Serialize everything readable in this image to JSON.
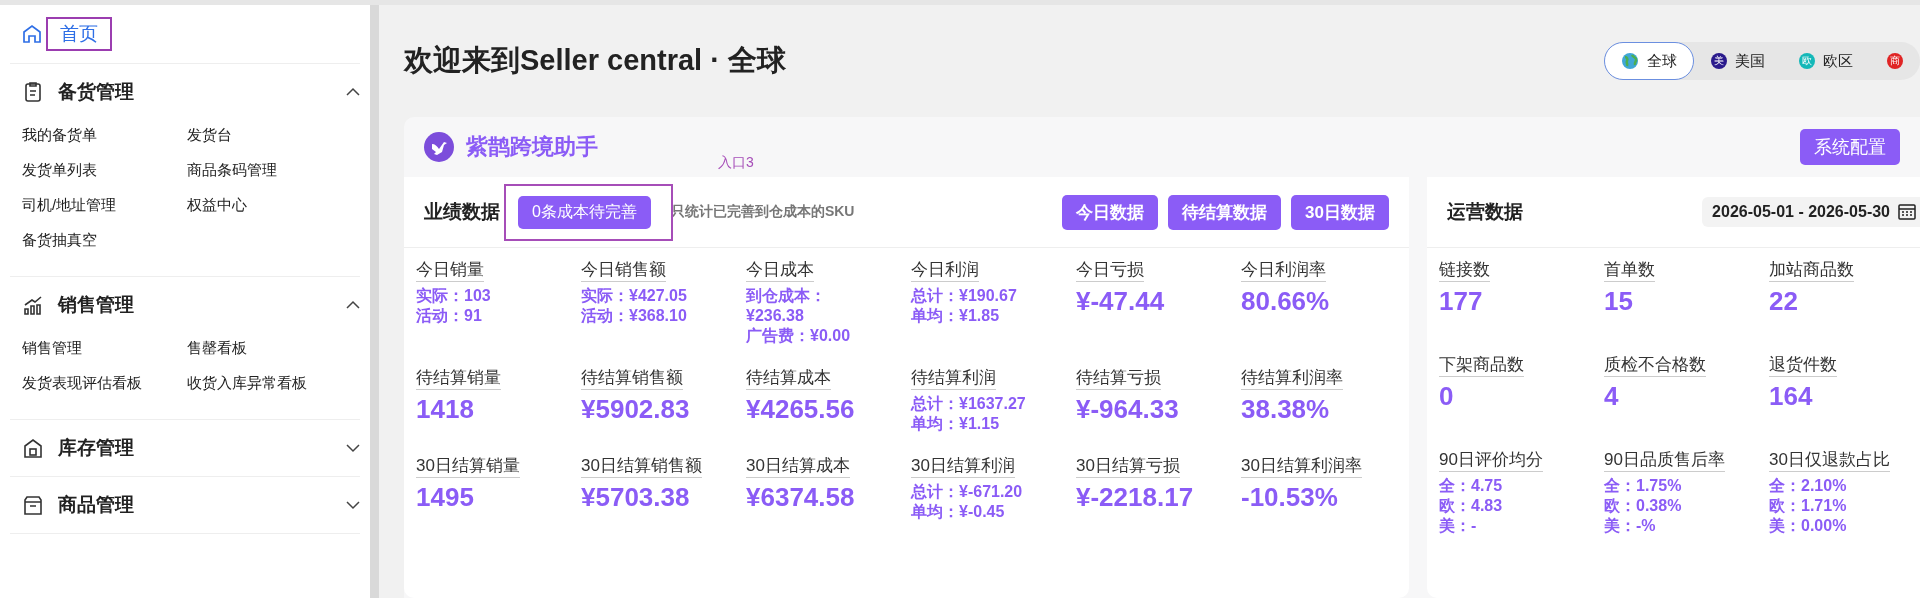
{
  "sidebar": {
    "home": {
      "label": "首页",
      "outlined": true
    },
    "sections": [
      {
        "label": "备货管理",
        "kind": "clipboard",
        "expanded": true,
        "items": [
          "我的备货单",
          "发货台",
          "发货单列表",
          "商品条码管理",
          "司机/地址管理",
          "权益中心",
          "备货抽真空"
        ]
      },
      {
        "label": "销售管理",
        "kind": "chart",
        "expanded": true,
        "items": [
          "销售管理",
          "售罄看板",
          "发货表现评估看板",
          "收货入库异常看板"
        ]
      },
      {
        "label": "库存管理",
        "kind": "warehouse",
        "expanded": false
      },
      {
        "label": "商品管理",
        "kind": "box",
        "expanded": false
      }
    ]
  },
  "header": {
    "title": "欢迎来到Seller central · 全球",
    "regions": [
      {
        "label": "全球",
        "color": "#3fa7d6",
        "selected": true
      },
      {
        "label": "美国",
        "badge": "美",
        "color": "#2a1a8c",
        "selected": false
      },
      {
        "label": "欧区",
        "badge": "欧",
        "color": "#14b8b8",
        "selected": false
      },
      {
        "badge": "商",
        "color": "#e02424",
        "selected": false
      }
    ]
  },
  "card": {
    "brand": "紫鹊跨境助手",
    "config_button": "系统配置",
    "performance": {
      "title": "业绩数据",
      "pending_button": {
        "label": "0条成本待完善",
        "outlined": true,
        "annotation": "入口3"
      },
      "note": "只统计已完善到仓成本的SKU",
      "range_buttons": [
        "今日数据",
        "待结算数据",
        "30日数据"
      ],
      "metrics": [
        {
          "label": "今日销量",
          "kind": "lines",
          "lines": [
            "实际：103",
            "活动：91"
          ]
        },
        {
          "label": "今日销售额",
          "kind": "lines",
          "lines": [
            "实际：¥427.05",
            "活动：¥368.10"
          ]
        },
        {
          "label": "今日成本",
          "kind": "lines",
          "lines": [
            "到仓成本：",
            "¥236.38",
            "广告费：¥0.00"
          ]
        },
        {
          "label": "今日利润",
          "kind": "lines",
          "lines": [
            "总计：¥190.67",
            "单均：¥1.85"
          ]
        },
        {
          "label": "今日亏损",
          "kind": "big",
          "value": "¥-47.44"
        },
        {
          "label": "今日利润率",
          "kind": "big",
          "value": "80.66%"
        },
        {
          "label": "待结算销量",
          "kind": "big",
          "value": "1418"
        },
        {
          "label": "待结算销售额",
          "kind": "big",
          "value": "¥5902.83"
        },
        {
          "label": "待结算成本",
          "kind": "big",
          "value": "¥4265.56"
        },
        {
          "label": "待结算利润",
          "kind": "lines",
          "lines": [
            "总计：¥1637.27",
            "单均：¥1.15"
          ]
        },
        {
          "label": "待结算亏损",
          "kind": "big",
          "value": "¥-964.33"
        },
        {
          "label": "待结算利润率",
          "kind": "big",
          "value": "38.38%"
        },
        {
          "label": "30日结算销量",
          "kind": "big",
          "value": "1495"
        },
        {
          "label": "30日结算销售额",
          "kind": "big",
          "value": "¥5703.38"
        },
        {
          "label": "30日结算成本",
          "kind": "big",
          "value": "¥6374.58"
        },
        {
          "label": "30日结算利润",
          "kind": "lines",
          "lines": [
            "总计：¥-671.20",
            "单均：¥-0.45"
          ]
        },
        {
          "label": "30日结算亏损",
          "kind": "big",
          "value": "¥-2218.17"
        },
        {
          "label": "30日结算利润率",
          "kind": "big",
          "value": "-10.53%"
        }
      ]
    },
    "operations": {
      "title": "运营数据",
      "date_range": "2026-05-01 - 2026-05-30",
      "metrics": [
        {
          "label": "链接数",
          "kind": "big",
          "value": "177"
        },
        {
          "label": "首单数",
          "kind": "big",
          "value": "15"
        },
        {
          "label": "加站商品数",
          "kind": "big",
          "value": "22"
        },
        {
          "label": "下架商品数",
          "kind": "big",
          "value": "0"
        },
        {
          "label": "质检不合格数",
          "kind": "big",
          "value": "4"
        },
        {
          "label": "退货件数",
          "kind": "big",
          "value": "164"
        },
        {
          "label": "90日评价均分",
          "kind": "lines",
          "lines": [
            "全：4.75",
            "欧：4.83",
            "美：-"
          ]
        },
        {
          "label": "90日品质售后率",
          "kind": "lines",
          "lines": [
            "全：1.75%",
            "欧：0.38%",
            "美：-%"
          ]
        },
        {
          "label": "30日仅退款占比",
          "kind": "lines",
          "lines": [
            "全：2.10%",
            "欧：1.71%",
            "美：0.00%"
          ]
        }
      ]
    }
  }
}
